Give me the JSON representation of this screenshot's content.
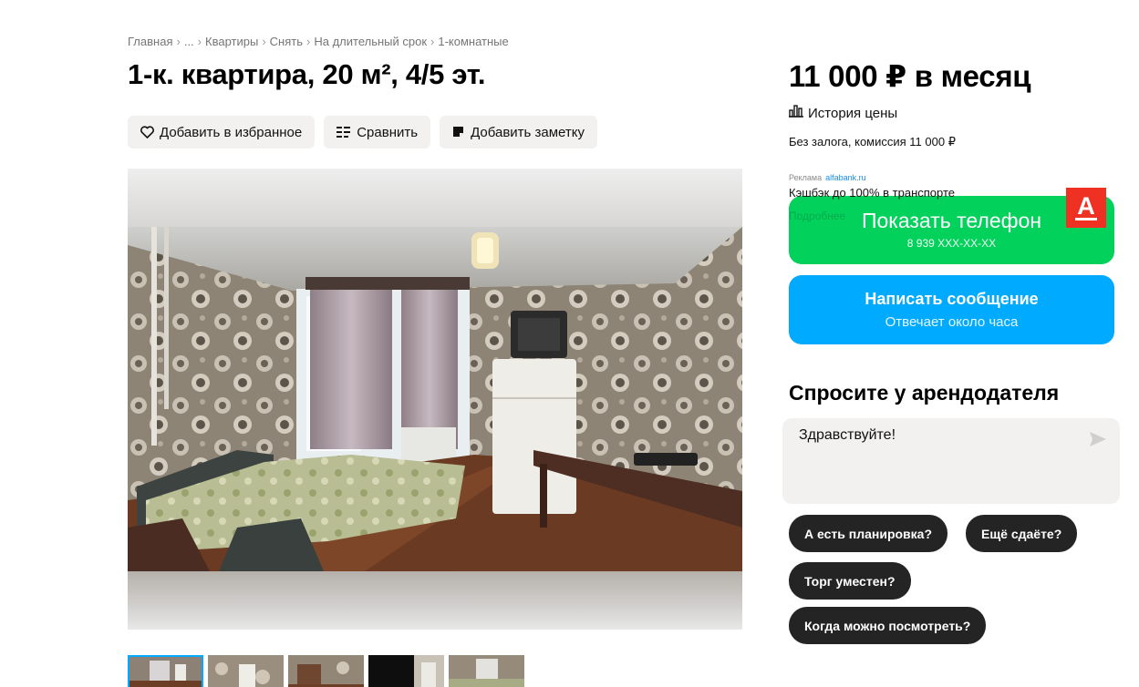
{
  "breadcrumb": {
    "items": [
      "Главная",
      "...",
      "Квартиры",
      "Снять",
      "На длительный срок",
      "1-комнатные"
    ],
    "separator": "›"
  },
  "listing": {
    "title": "1-к. квартира, 20 м², 4/5 эт.",
    "actions": {
      "favorite": "Добавить в избранное",
      "compare": "Сравнить",
      "note": "Добавить заметку"
    }
  },
  "gallery": {
    "thumbnail_count": 5,
    "active_index": 0
  },
  "sidebar": {
    "price": "11 000 ₽ в месяц",
    "price_history": "История цены",
    "deposit": "Без залога, комиссия 11 000 ₽",
    "ad": {
      "label": "Реклама",
      "domain": "alfabank.ru",
      "text": "Кэшбэк до 100% в транспорте",
      "more": "Подробнее",
      "logo_letter": "А"
    },
    "phone_button": {
      "label": "Показать телефон",
      "number": "8 939 XXX-XX-XX"
    },
    "message_button": {
      "label": "Написать сообщение",
      "sub": "Отвечает около часа"
    },
    "ask": {
      "title": "Спросите у арендодателя",
      "input_value": "Здравствуйте!"
    },
    "quick_questions": [
      "А есть планировка?",
      "Ещё сдаёте?",
      "Торг уместен?",
      "Когда можно посмотреть?"
    ]
  },
  "colors": {
    "phone_green": "#02d15c",
    "message_blue": "#00aaff",
    "chip_dark": "#242424",
    "alfa_red": "#ef3124"
  }
}
